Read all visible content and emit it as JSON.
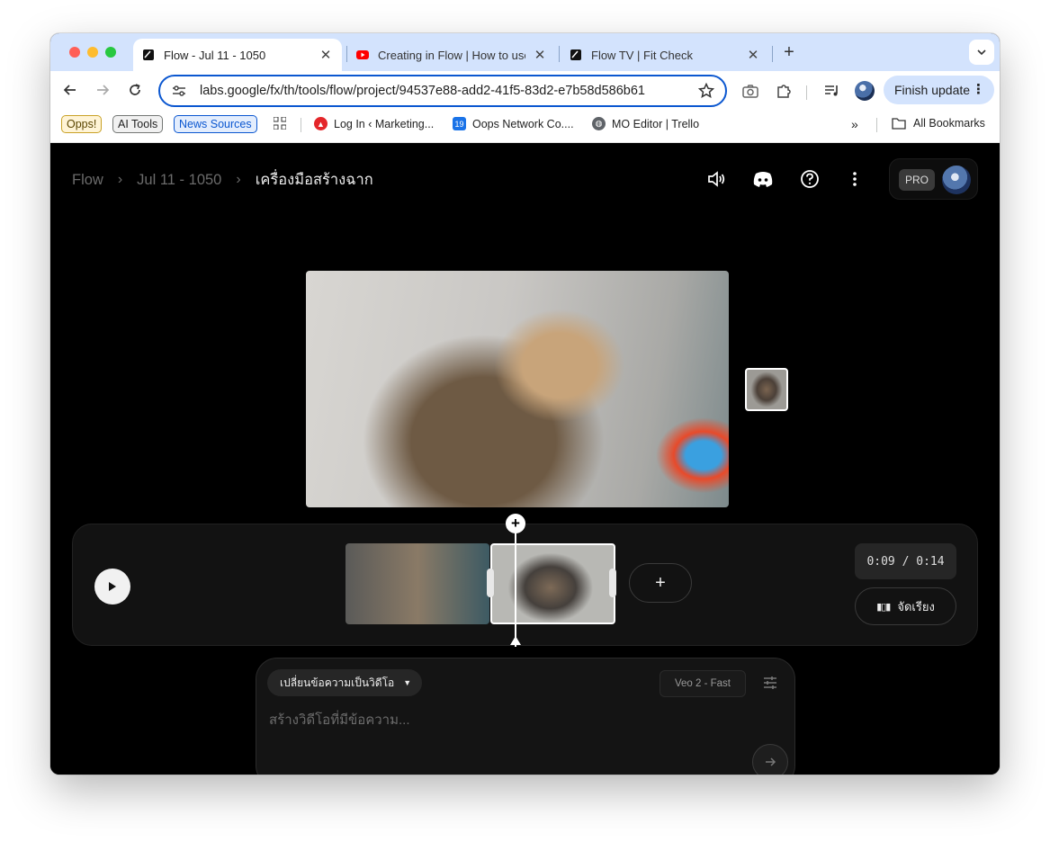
{
  "browser": {
    "tabs": [
      {
        "title": "Flow - Jul 11 - 1050",
        "active": true,
        "icon": "flow-icon"
      },
      {
        "title": "Creating in Flow | How to use",
        "active": false,
        "icon": "youtube-icon"
      },
      {
        "title": "Flow TV | Fit Check",
        "active": false,
        "icon": "flow-icon"
      }
    ],
    "close_glyph": "✕",
    "new_tab_glyph": "+",
    "url": "labs.google/fx/th/tools/flow/project/94537e88-add2-41f5-83d2-e7b58d586b61",
    "finish_update_label": "Finish update",
    "bookmarks": {
      "chips": [
        {
          "label": "Opps!",
          "bg": "#fff4d6",
          "border": "#c9a227",
          "color": "#5a4500"
        },
        {
          "label": "AI Tools",
          "bg": "#f1f1f1",
          "border": "#747775",
          "color": "#1f1f1f"
        },
        {
          "label": "News Sources",
          "bg": "#e3edfd",
          "border": "#0b57d0",
          "color": "#0b57d0"
        }
      ],
      "links": [
        {
          "label": "Log In ‹ Marketing...",
          "icon": "marketing-icon"
        },
        {
          "label": "Oops Network Co....",
          "icon": "calendar-icon"
        },
        {
          "label": "MO Editor | Trello",
          "icon": "globe-icon"
        }
      ],
      "all_bookmarks_label": "All Bookmarks"
    }
  },
  "app": {
    "breadcrumbs": [
      "Flow",
      "Jul 11 - 1050",
      "เครื่องมือสร้างฉาก"
    ],
    "pro_badge": "PRO",
    "timeline": {
      "timecode": "0:09 / 0:14",
      "arrange_label": "จัดเรียง",
      "add_label": "+"
    },
    "prompt": {
      "mode_label": "เปลี่ยนข้อความเป็นวิดีโอ",
      "model_label": "Veo 2 - Fast",
      "placeholder": "สร้างวิดีโอที่มีข้อความ..."
    }
  },
  "colors": {
    "accent": "#0b57d0",
    "app_background": "#000000",
    "tab_strip": "#d3e3fd"
  }
}
